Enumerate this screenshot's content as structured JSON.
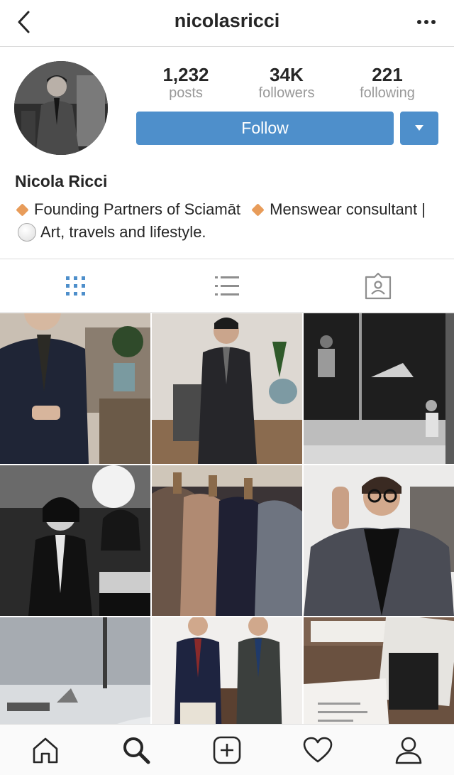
{
  "header": {
    "username": "nicolasricci",
    "back_icon": "chevron-left-icon",
    "more_icon": "more-horizontal-icon"
  },
  "profile": {
    "stats": [
      {
        "value": "1,232",
        "label": "posts"
      },
      {
        "value": "34K",
        "label": "followers"
      },
      {
        "value": "221",
        "label": "following"
      }
    ],
    "follow_label": "Follow",
    "name": "Nicola Ricci",
    "bio_part1": "Founding Partners of Sciamāt",
    "bio_part2": "Menswear consultant |",
    "bio_part3": "Art, travels and lifestyle.",
    "accent_color": "#4e8fcb"
  },
  "tabs": [
    {
      "name": "grid-view",
      "icon": "grid-icon",
      "active": true
    },
    {
      "name": "list-view",
      "icon": "list-icon",
      "active": false
    },
    {
      "name": "tagged",
      "icon": "tagged-person-icon",
      "active": false
    }
  ],
  "grid": {
    "photos": [
      "man-in-navy-suit-holding-glasses",
      "man-in-dark-suit-by-plant",
      "black-and-white-gallery-window",
      "couple-at-event-black-and-white",
      "jackets-on-hangers",
      "man-on-phone-in-houndstooth-jacket",
      "airport-tarmac-plane",
      "two-men-in-suits-thumbs-up",
      "documents-and-booklet-on-desk"
    ]
  },
  "bottom_nav": [
    {
      "name": "home",
      "icon": "home-icon"
    },
    {
      "name": "search",
      "icon": "search-icon"
    },
    {
      "name": "new-post",
      "icon": "plus-square-icon"
    },
    {
      "name": "activity",
      "icon": "heart-icon"
    },
    {
      "name": "profile",
      "icon": "user-icon"
    }
  ]
}
